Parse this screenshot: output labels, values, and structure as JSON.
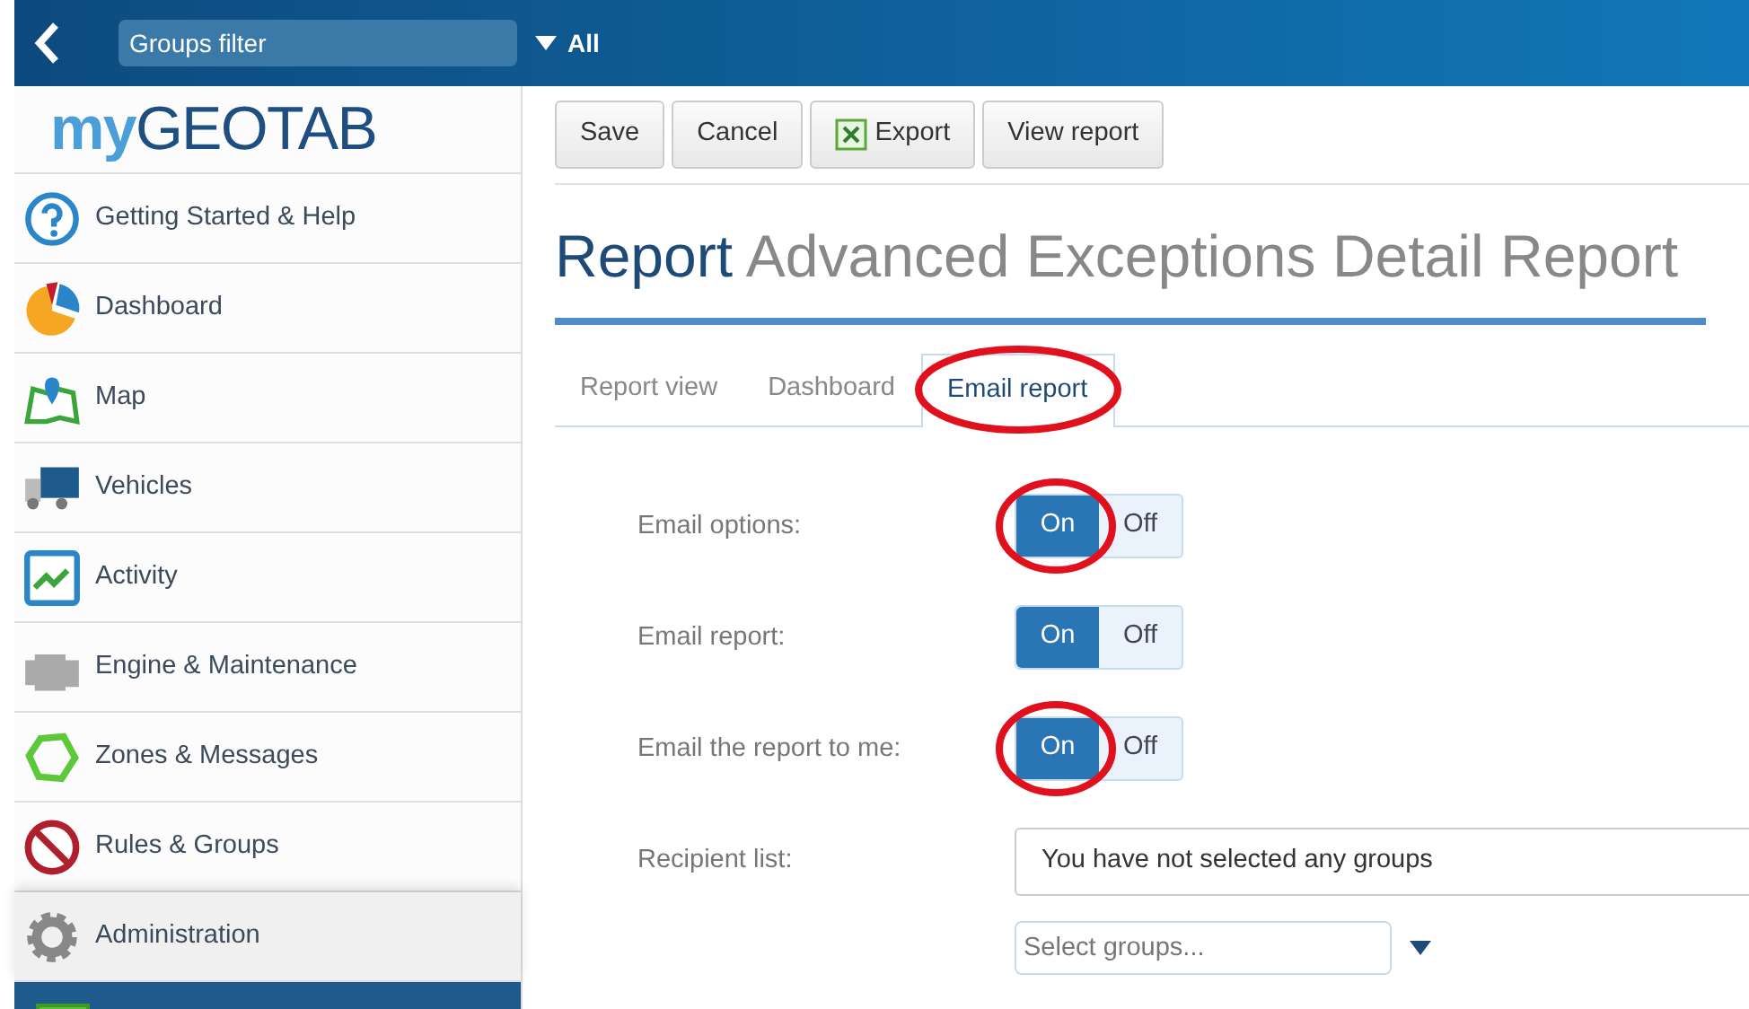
{
  "top_bar": {
    "groups_filter": {
      "placeholder": "Groups filter"
    },
    "filter_value": "All"
  },
  "logo": {
    "part_1": "my",
    "part_2": "GEOTAB"
  },
  "sidebar": {
    "items": [
      {
        "label": "Getting Started & Help",
        "kind": "help",
        "selected": false
      },
      {
        "label": "Dashboard",
        "kind": "pie",
        "selected": false
      },
      {
        "label": "Map",
        "kind": "map",
        "selected": false
      },
      {
        "label": "Vehicles",
        "kind": "truck",
        "selected": false
      },
      {
        "label": "Activity",
        "kind": "activity",
        "selected": false
      },
      {
        "label": "Engine & Maintenance",
        "kind": "engine",
        "selected": false
      },
      {
        "label": "Zones & Messages",
        "kind": "zone",
        "selected": false
      },
      {
        "label": "Rules & Groups",
        "kind": "rules",
        "selected": false
      },
      {
        "label": "Administration",
        "kind": "gear",
        "selected": true
      }
    ]
  },
  "toolbar": {
    "buttons": [
      {
        "label": "Save",
        "kind": "plain"
      },
      {
        "label": "Cancel",
        "kind": "plain"
      },
      {
        "label": "Export",
        "kind": "export"
      },
      {
        "label": "View report",
        "kind": "plain"
      }
    ]
  },
  "title": {
    "prefix": "Report",
    "name": "Advanced Exceptions Detail Report"
  },
  "tabs": [
    {
      "label": "Report view",
      "selected": false,
      "circled": false
    },
    {
      "label": "Dashboard",
      "selected": false,
      "circled": false
    },
    {
      "label": "Email report",
      "selected": true,
      "circled": true
    }
  ],
  "settings": [
    {
      "kind": "toggle",
      "label": "Email options:",
      "on_label": "On",
      "off_label": "Off",
      "on": true,
      "circled": true
    },
    {
      "kind": "toggle",
      "label": "Email report:",
      "on_label": "On",
      "off_label": "Off",
      "on": true,
      "circled": false
    },
    {
      "kind": "toggle",
      "label": "Email the report to me:",
      "on_label": "On",
      "off_label": "Off",
      "on": true,
      "circled": true
    },
    {
      "kind": "recipients",
      "label": "Recipient list:",
      "value": "You have not selected any groups",
      "select_placeholder": "Select groups..."
    }
  ]
}
